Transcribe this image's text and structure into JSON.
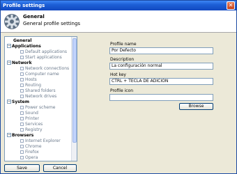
{
  "window": {
    "title": "Profile settings",
    "close_glyph": "✕"
  },
  "header": {
    "title": "General",
    "subtitle": "General profile settings",
    "icon": "gear-icon"
  },
  "tree": {
    "items": [
      {
        "label": "General",
        "kind": "cat",
        "expander": ""
      },
      {
        "label": "Applications",
        "kind": "cat",
        "expander": "⊟"
      },
      {
        "label": "Default applications",
        "kind": "sub"
      },
      {
        "label": "Start applications",
        "kind": "sub"
      },
      {
        "label": "Network",
        "kind": "cat",
        "expander": "⊟"
      },
      {
        "label": "Network connections",
        "kind": "sub"
      },
      {
        "label": "Computer name",
        "kind": "sub"
      },
      {
        "label": "Hosts",
        "kind": "sub"
      },
      {
        "label": "Routing",
        "kind": "sub"
      },
      {
        "label": "Shared folders",
        "kind": "sub"
      },
      {
        "label": "Network drives",
        "kind": "sub"
      },
      {
        "label": "System",
        "kind": "cat",
        "expander": "⊟"
      },
      {
        "label": "Power scheme",
        "kind": "sub"
      },
      {
        "label": "Sound",
        "kind": "sub"
      },
      {
        "label": "Printer",
        "kind": "sub"
      },
      {
        "label": "Services",
        "kind": "sub"
      },
      {
        "label": "Registry",
        "kind": "sub"
      },
      {
        "label": "Browsers",
        "kind": "cat",
        "expander": "⊟"
      },
      {
        "label": "Internet Explorer",
        "kind": "sub"
      },
      {
        "label": "Chrome",
        "kind": "sub"
      },
      {
        "label": "Firefox",
        "kind": "sub"
      },
      {
        "label": "Opera",
        "kind": "sub"
      }
    ]
  },
  "form": {
    "profile_name_label": "Profile name",
    "profile_name_value": "Por Defecto",
    "description_label": "Description",
    "description_value": "La configuración normal",
    "hotkey_label": "Hot key",
    "hotkey_value": "CTRL + TECLA DE ADICION",
    "profile_icon_label": "Profile icon",
    "profile_icon_value": "",
    "browse_label": "Browse"
  },
  "footer": {
    "save_label": "Save",
    "cancel_label": "Cancel"
  }
}
